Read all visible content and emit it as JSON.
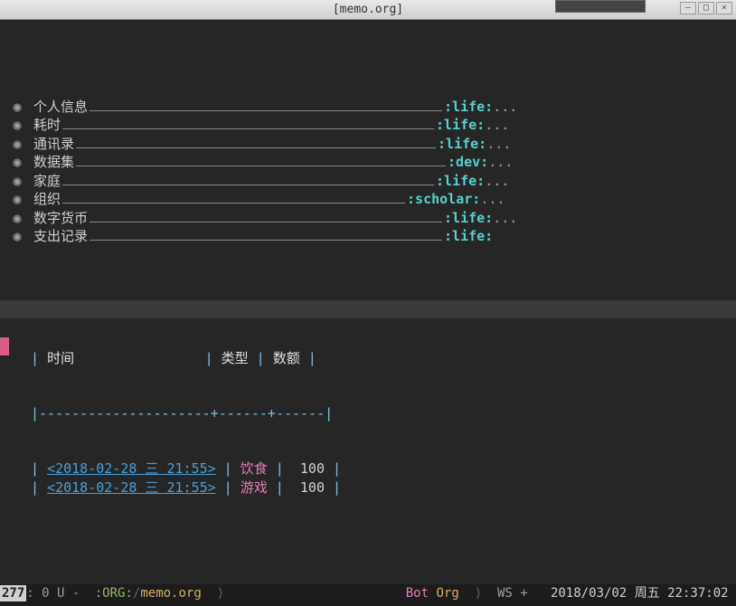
{
  "window": {
    "title": "[memo.org]"
  },
  "headings": [
    {
      "title": "个人信息",
      "tag": ":life:",
      "folded": true,
      "fill": 390
    },
    {
      "title": "耗时",
      "tag": ":life:",
      "folded": true,
      "fill": 411
    },
    {
      "title": "通讯录",
      "tag": ":life:",
      "folded": true,
      "fill": 398
    },
    {
      "title": "数据集",
      "tag": ":dev:",
      "folded": true,
      "fill": 409
    },
    {
      "title": "家庭",
      "tag": ":life:",
      "folded": true,
      "fill": 411
    },
    {
      "title": "组织",
      "tag": ":scholar:",
      "folded": true,
      "fill": 379
    },
    {
      "title": "数字货币",
      "tag": ":life:",
      "folded": true,
      "fill": 390
    },
    {
      "title": "支出记录",
      "tag": ":life:",
      "folded": false,
      "fill": 390
    }
  ],
  "table": {
    "headers": {
      "c1": "时间",
      "c2": "类型",
      "c3": "数额"
    },
    "separator": "|---------------------+------+------|",
    "rows": [
      {
        "date": "<2018-02-28 三 21:55>",
        "type": "饮食",
        "amount": "100"
      },
      {
        "date": "<2018-02-28 三 21:55>",
        "type": "游戏",
        "amount": "100"
      }
    ]
  },
  "modeline": {
    "line": "277",
    "state": ": 0 U -",
    "mode_tag": ":ORG:",
    "path_sep": "/",
    "filename": "memo.org",
    "position": "Bot",
    "major_mode": "Org",
    "ws": "WS +",
    "date": "2018/03/02",
    "day": "周五",
    "time": "22:37:02"
  }
}
